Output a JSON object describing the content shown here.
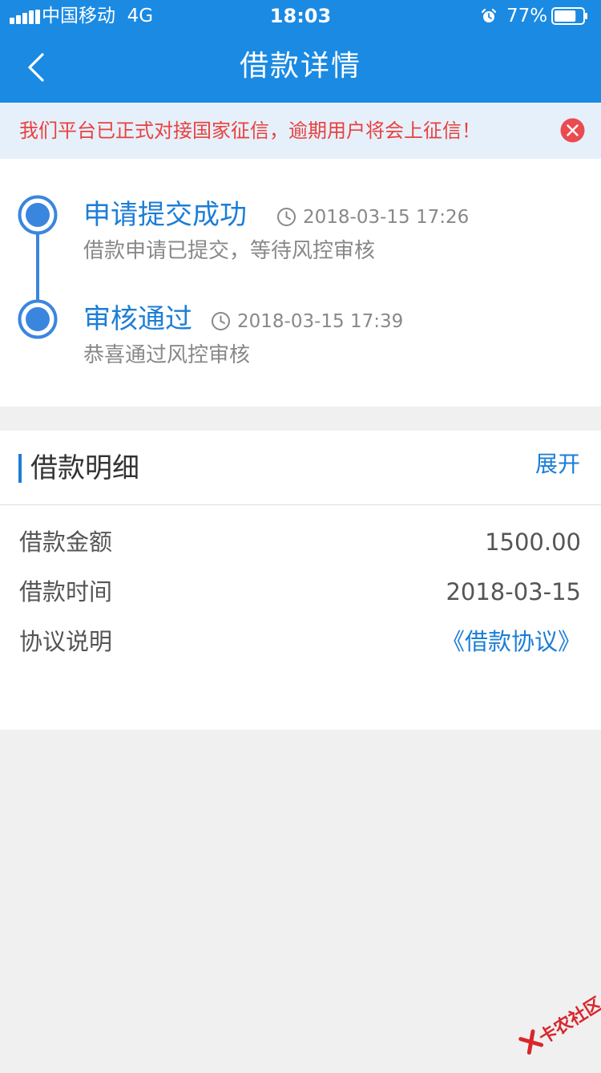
{
  "status_bar": {
    "carrier": "中国移动",
    "network": "4G",
    "time": "18:03",
    "battery_percent": "77%",
    "battery_level": 0.77
  },
  "nav": {
    "title": "借款详情",
    "back_icon": "chevron-left-icon"
  },
  "notice": {
    "text": "我们平台已正式对接国家征信，逾期用户将会上征信！",
    "close_icon": "close-circle-icon",
    "color": "#e8413f"
  },
  "timeline": [
    {
      "title": "申请提交成功",
      "time": "2018-03-15 17:26",
      "desc": "借款申请已提交，等待风控审核"
    },
    {
      "title": "审核通过",
      "time": "2018-03-15 17:39",
      "desc": "恭喜通过风控审核"
    }
  ],
  "detail": {
    "title": "借款明细",
    "toggle": "展开",
    "rows": [
      {
        "label": "借款金额",
        "value": "1500.00"
      },
      {
        "label": "借款时间",
        "value": "2018-03-15"
      },
      {
        "label": "协议说明",
        "value": "《借款协议》"
      }
    ]
  },
  "watermark": {
    "text": "卡农社区"
  },
  "colors": {
    "brand": "#1a8ae3",
    "accent": "#1c7ed6",
    "warning": "#e8413f"
  }
}
